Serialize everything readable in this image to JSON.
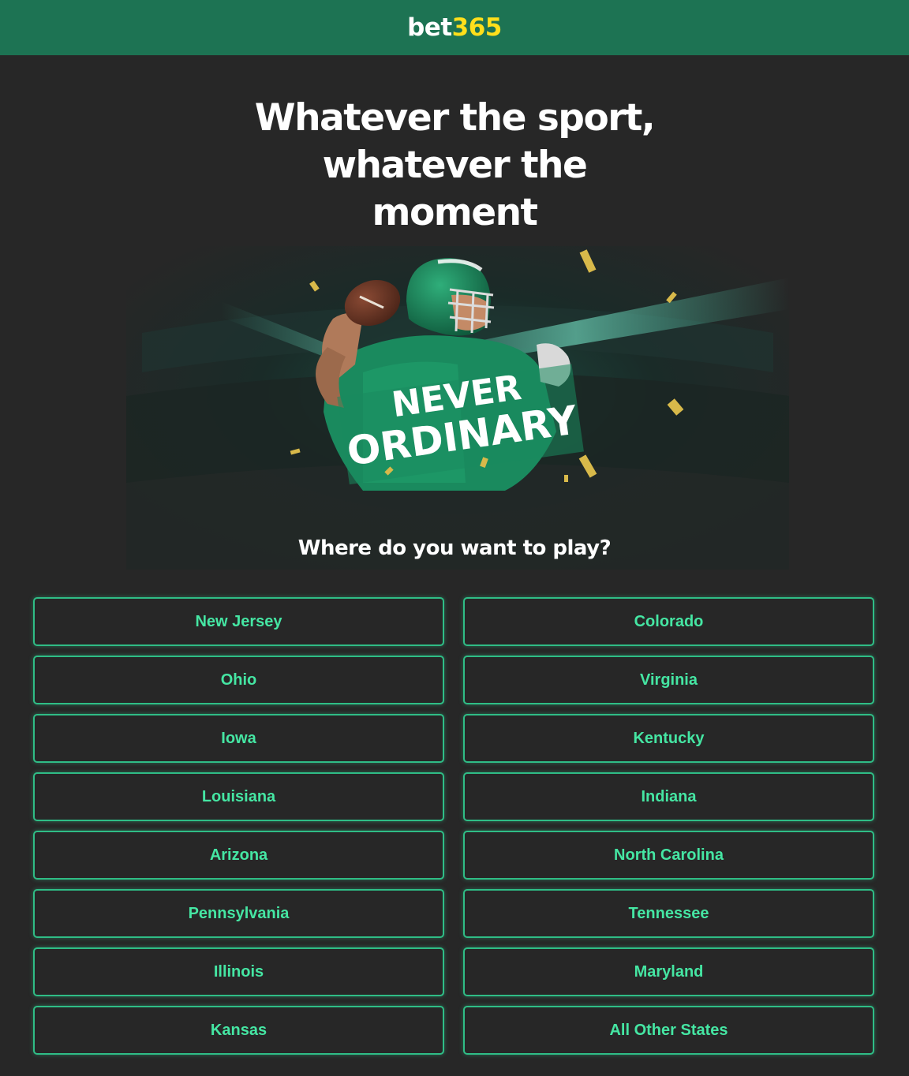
{
  "header": {
    "logo_text": "bet",
    "logo_number": "365"
  },
  "headline": {
    "lines": [
      "Whatever the sport,",
      "whatever the",
      "moment"
    ]
  },
  "hero": {
    "tagline_line1": "NEVER",
    "tagline_line2": "ORDINARY"
  },
  "question": "Where do you want to play?",
  "states": [
    "New Jersey",
    "Colorado",
    "Ohio",
    "Virginia",
    "Iowa",
    "Kentucky",
    "Louisiana",
    "Indiana",
    "Arizona",
    "North Carolina",
    "Pennsylvania",
    "Tennessee",
    "Illinois",
    "Maryland",
    "Kansas",
    "All Other States"
  ],
  "colors": {
    "brand_green": "#1d7353",
    "accent_yellow": "#ffdf1b",
    "button_border": "#2fbd86",
    "button_text": "#45e6a3",
    "background": "#272727"
  }
}
